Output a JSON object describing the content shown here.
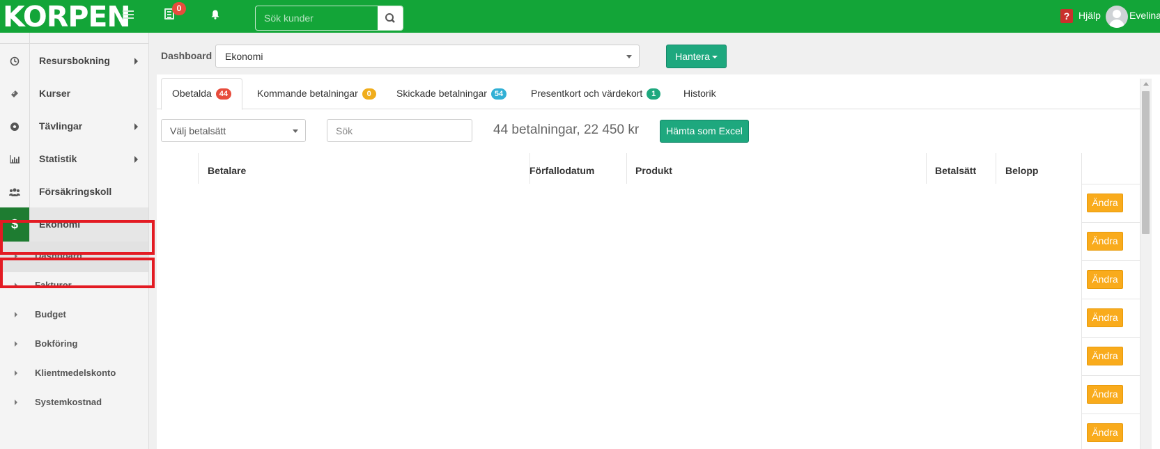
{
  "topbar": {
    "logo": "KORPEN",
    "notification_count": "0",
    "search_placeholder": "Sök kunder",
    "help_label": "Hjälp",
    "username": "Evelina"
  },
  "sidebar": {
    "items": [
      {
        "label": "Resursbokning",
        "icon": "clock-icon"
      },
      {
        "label": "Kurser",
        "icon": "ticket-icon"
      },
      {
        "label": "Tävlingar",
        "icon": "soccer-ball-icon"
      },
      {
        "label": "Statistik",
        "icon": "bar-chart-icon"
      },
      {
        "label": "Försäkringskoll",
        "icon": "users-icon"
      },
      {
        "label": "Ekonomi",
        "icon": "dollar-icon",
        "icon_text": "$"
      }
    ],
    "subitems": [
      {
        "label": "Dashboard"
      },
      {
        "label": "Fakturor"
      },
      {
        "label": "Budget"
      },
      {
        "label": "Bokföring"
      },
      {
        "label": "Klientmedelskonto"
      },
      {
        "label": "Systemkostnad"
      }
    ]
  },
  "toolbar": {
    "dashboard_label": "Dashboard",
    "dashboard_value": "Ekonomi",
    "hantera_label": "Hantera"
  },
  "tabs": [
    {
      "label": "Obetalda",
      "count": "44",
      "color": "#e74c3c"
    },
    {
      "label": "Kommande betalningar",
      "count": "0",
      "color": "#f0ad1c"
    },
    {
      "label": "Skickade betalningar",
      "count": "54",
      "color": "#31b0d5"
    },
    {
      "label": "Presentkort och värdekort",
      "count": "1",
      "color": "#1ea87e"
    },
    {
      "label": "Historik"
    }
  ],
  "filters": {
    "payment_method_placeholder": "Välj betalsätt",
    "search_placeholder": "Sök",
    "summary": "44 betalningar, 22 450 kr",
    "excel_label": "Hämta som Excel"
  },
  "table": {
    "columns": [
      "Betalare",
      "Förfallodatum",
      "Produkt",
      "Betalsätt",
      "Belopp"
    ],
    "row_action_label": "Ändra"
  },
  "colors": {
    "brand_green": "#13a538",
    "action_teal": "#1ea87e",
    "edit_orange": "#f9ab1c",
    "highlight_red": "#e31b23"
  }
}
